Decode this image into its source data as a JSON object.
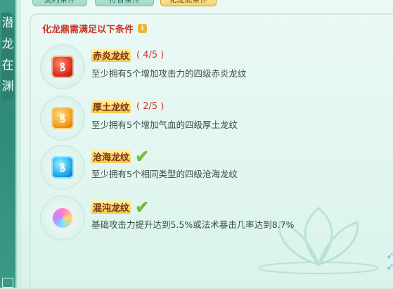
{
  "side_title": [
    "潜",
    "龙",
    "在",
    "渊"
  ],
  "tabs": [
    {
      "label": "契约条件"
    },
    {
      "label": "符合条件"
    },
    {
      "label": "化龙鼎条件"
    }
  ],
  "header": {
    "title": "化龙鼎需满足以下条件",
    "info_icon": "i"
  },
  "conditions": [
    {
      "name": "赤炎龙纹",
      "progress": "( 4/5 )",
      "completed": false,
      "desc": "至少拥有5个增加攻击力的四级赤炎龙纹",
      "gem_color": "#d92d1f",
      "icon": "red-gem-icon"
    },
    {
      "name": "厚土龙纹",
      "progress": "( 2/5 )",
      "completed": false,
      "desc": "至少拥有5个增加气血的四级厚土龙纹",
      "gem_color": "#f29b1a",
      "icon": "orange-gem-icon"
    },
    {
      "name": "沧海龙纹",
      "progress": "",
      "completed": true,
      "desc": "至少拥有5个相同类型的四级沧海龙纹",
      "gem_color": "#1aa5e8",
      "icon": "blue-gem-icon"
    },
    {
      "name": "混沌龙纹",
      "progress": "",
      "completed": true,
      "desc": "基础攻击力提升达到5.5%或法术暴击几率达到8.7%",
      "gem_color": "#ff7bd3",
      "icon": "rainbow-gem-icon"
    }
  ],
  "check_glyph": "✔"
}
